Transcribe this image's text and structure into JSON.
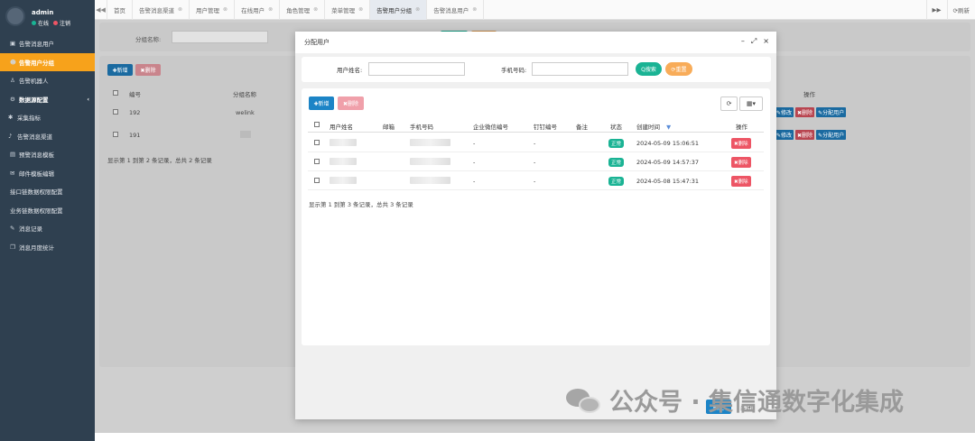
{
  "sidebar": {
    "user": {
      "name": "admin",
      "online": "在线",
      "logout": "注销"
    },
    "items": [
      {
        "icon": "file-icon",
        "glyph": "▣",
        "label": "告警消息用户"
      },
      {
        "icon": "users-icon",
        "glyph": "☻",
        "label": "告警用户分组"
      },
      {
        "icon": "robot-icon",
        "glyph": "♙",
        "label": "告警机器人"
      },
      {
        "icon": "gear-icon",
        "glyph": "⚙",
        "label": "数据源配置"
      },
      {
        "icon": "sync-icon",
        "glyph": "✱",
        "label": "采集指标"
      },
      {
        "icon": "bell-icon",
        "glyph": "♪",
        "label": "告警消息渠道"
      },
      {
        "icon": "template-icon",
        "glyph": "▤",
        "label": "预警消息模板"
      },
      {
        "icon": "mail-icon",
        "glyph": "✉",
        "label": "邮件模板编辑"
      },
      {
        "icon": "",
        "glyph": "",
        "label": "接口链数据权限配置"
      },
      {
        "icon": "",
        "glyph": "",
        "label": "业务链数据权限配置"
      },
      {
        "icon": "edit-icon",
        "glyph": "✎",
        "label": "消息记录"
      },
      {
        "icon": "copy-icon",
        "glyph": "❐",
        "label": "消息月度统计"
      }
    ]
  },
  "tabs": {
    "prev": "◀◀",
    "items": [
      "首页",
      "告警消息渠道",
      "用户管理",
      "在线用户",
      "角色管理",
      "菜单管理",
      "告警用户分组",
      "告警消息用户"
    ],
    "next": "▶▶",
    "refresh": "⟳刷新"
  },
  "background": {
    "group_label": "分组名称:",
    "add": "✚新增",
    "delete": "✖删除",
    "col_id": "编号",
    "col_name": "分组名称",
    "col_ops": "操作",
    "rows": [
      {
        "id": "192",
        "name": "welink"
      },
      {
        "id": "191",
        "name": ""
      }
    ],
    "pager": "显示第 1 到第 2 条记录，总共 2 条记录",
    "op_edit": "✎修改",
    "op_delete": "✖删除",
    "op_assign": "✎分配用户"
  },
  "modal": {
    "title": "分配用户",
    "controls": [
      "–",
      "⤢",
      "×"
    ],
    "search": {
      "name_label": "用户姓名:",
      "phone_label": "手机号码:",
      "search_btn": "Q搜索",
      "reset_btn": "⟳重置"
    },
    "toolbar": {
      "add": "✚新增",
      "delete": "✖删除",
      "refresh": "⟳",
      "columns": "▦▾"
    },
    "columns": [
      "用户姓名",
      "邮箱",
      "手机号码",
      "企业微信编号",
      "钉钉编号",
      "备注",
      "状态",
      "创建时间",
      "操作"
    ],
    "sort_icon": "▼",
    "rows": [
      {
        "wechat": "-",
        "dingtalk": "-",
        "status": "正常",
        "created": "2024-05-09 15:06:51",
        "op": "✖删除"
      },
      {
        "wechat": "-",
        "dingtalk": "-",
        "status": "正常",
        "created": "2024-05-09 14:57:37",
        "op": "✖删除"
      },
      {
        "wechat": "-",
        "dingtalk": "-",
        "status": "正常",
        "created": "2024-05-08 15:47:31",
        "op": "✖删除"
      }
    ],
    "pager": "显示第 1 到第 3 条记录，总共 3 条记录",
    "ok": "确定",
    "close": "关闭"
  },
  "watermark": "公众号 · 集信通数字化集成",
  "colors": {
    "sidebar": "#2f4050",
    "active": "#f7a21b",
    "primary": "#1c84c6",
    "danger": "#ed5565",
    "success": "#1ab394",
    "warning": "#f8ac59"
  }
}
